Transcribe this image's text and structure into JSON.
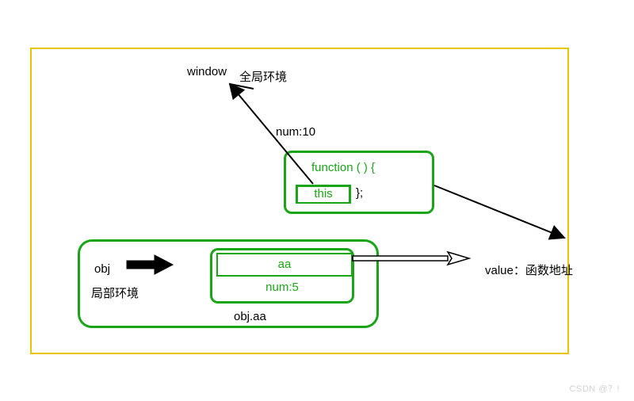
{
  "labels": {
    "window": "window",
    "global_env": "全局环境",
    "num_global": "num:10",
    "fn_open": "function ( ) {",
    "this_kw": "this",
    "fn_close": "};",
    "obj": "obj",
    "local_env": "局部环境",
    "aa_row": "aa",
    "num_local": "num:5",
    "obj_aa": "obj.aa",
    "value_label": "value：函数地址",
    "watermark": "CSDN @？!"
  }
}
